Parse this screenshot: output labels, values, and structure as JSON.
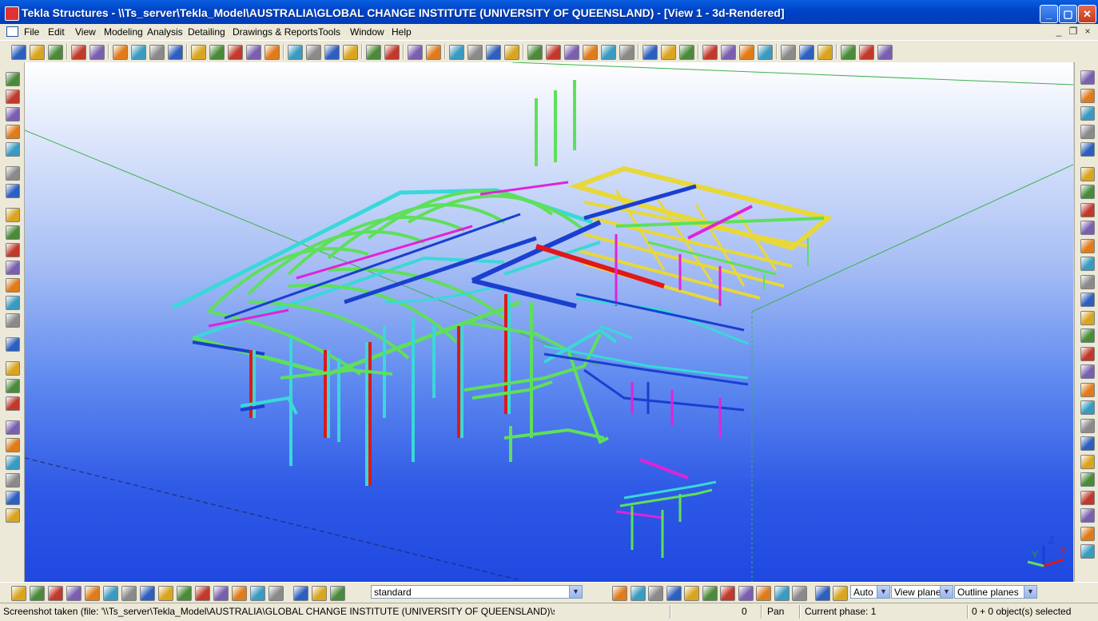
{
  "window": {
    "title": "Tekla Structures - \\\\Ts_server\\Tekla_Model\\AUSTRALIA\\GLOBAL CHANGE INSTITUTE (UNIVERSITY OF QUEENSLAND) - [View 1 - 3d-Rendered]",
    "minimize": "_",
    "maximize": "▢",
    "close": "✕"
  },
  "menu": {
    "items": [
      "File",
      "Edit",
      "View",
      "Modeling",
      "Analysis",
      "Detailing",
      "Drawings & Reports",
      "Tools",
      "Window",
      "Help"
    ],
    "mdi_min": "_",
    "mdi_restore": "❐",
    "mdi_close": "×"
  },
  "toolbar_icons": [
    "new-icon",
    "open-icon",
    "save-icon",
    "undo-icon",
    "redo-icon",
    "copy-icon",
    "paste-icon",
    "print-icon",
    "clipboard-icon",
    "view-icon",
    "window-icon",
    "list-icon",
    "cut-icon",
    "select-icon",
    "part-icon",
    "assembly-icon",
    "cast-unit-icon",
    "component-icon",
    "snap-icon",
    "move-icon",
    "rotate-icon",
    "mirror-icon",
    "query-icon",
    "inquire-icon",
    "dimension-icon",
    "grid-icon",
    "line-icon",
    "distance-icon",
    "angle-icon",
    "arc-icon",
    "point-icon",
    "measure-icon",
    "clash-icon",
    "numbering-icon",
    "phase-icon",
    "drawing-icon",
    "report-icon",
    "analysis-icon",
    "workplane-icon",
    "plane-icon",
    "cut-plane-icon",
    "clip-icon",
    "fly-icon",
    "zoom-icon",
    "settings-icon"
  ],
  "left_tools": [
    "column-icon",
    "beam-icon",
    "polybeam-icon",
    "curved-beam-icon",
    "slab-icon",
    "bolt-icon",
    "weld-icon",
    "line-point-icon",
    "pick-point-icon",
    "along-line-icon",
    "extension-icon",
    "intersect-icon",
    "perpendicular-icon",
    "parallel-icon",
    "circle-icon",
    "binoculars-icon",
    "component-catalog-icon",
    "component-icon",
    "detail-icon",
    "connection-icon",
    "edit-icon",
    "explode-icon",
    "group-icon",
    "ungroup-icon"
  ],
  "right_tools": [
    "plane-select-icon",
    "component-select-icon",
    "binoculars-icon",
    "arrow-left-icon",
    "arrow-right-icon",
    "number-five-icon",
    "ibeam-icon",
    "channel-icon",
    "hollow-section-icon",
    "tee-icon",
    "angle-section-icon",
    "plate-icon",
    "stiffener-icon",
    "seating-icon",
    "highlight-icon",
    "yellow-square-icon",
    "splice-icon",
    "endplate-icon",
    "cap-icon",
    "bracing-icon",
    "base-plate-icon",
    "clip-angle-icon",
    "stair-icon",
    "column-splice-icon",
    "haunch-icon",
    "truss-icon",
    "warning-icon"
  ],
  "bottom_icons": [
    "select-all-icon",
    "select-part-icon",
    "select-surface-icon",
    "select-weld-icon",
    "select-cut-icon",
    "select-grid-icon",
    "select-bolt-icon",
    "select-reinforcement-icon",
    "select-plane-icon",
    "select-point-icon",
    "select-component-icon",
    "select-assembly-icon",
    "select-object-icon",
    "select-cast-icon",
    "select-view-icon",
    "snap-point-icon",
    "snap-end-icon",
    "snap-center-icon"
  ],
  "bottom_snap_icons": [
    "snap-ref-line-icon",
    "snap-geometry-icon",
    "snap-center-snap-icon",
    "snap-intersection-icon",
    "snap-midpoint-icon",
    "snap-perpendicular-icon",
    "snap-extension-icon",
    "snap-nearest-icon",
    "snap-any-icon",
    "snap-free-icon",
    "snap-line-icon",
    "view-properties-icon",
    "work-area-icon"
  ],
  "selection_filter": "standard",
  "snap_combo": "Auto",
  "plane_combo": "View plane",
  "outline_combo": "Outline planes",
  "status": {
    "message": "Screenshot taken (file: '\\\\Ts_server\\Tekla_Model\\AUSTRALIA\\GLOBAL CHANGE INSTITUTE (UNIVERSITY OF QUEENSLAND)\\screenshots\\snap_",
    "count": "0",
    "mode": "Pan",
    "phase": "Current phase: 1",
    "selection": "0 + 0 object(s) selected"
  },
  "axis": {
    "x": "X",
    "y": "Y",
    "z": "Z"
  },
  "colors": {
    "green_member": "#5ee05a",
    "cyan_member": "#3ad8d8",
    "blue_member": "#1a3fd0",
    "magenta_member": "#e023d8",
    "red_member": "#e01818",
    "yellow_member": "#e8d838",
    "viewport_top": "#ffffff",
    "viewport_bottom": "#1f48e0"
  }
}
